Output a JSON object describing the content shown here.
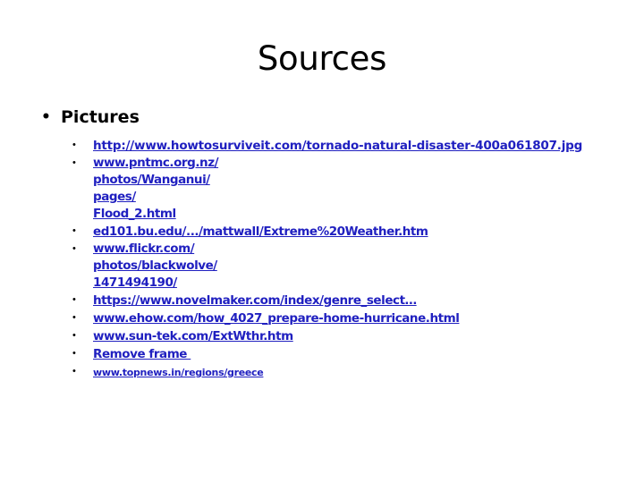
{
  "slide": {
    "title": "Sources",
    "background_color": "#FFFFFF",
    "title_color": "#000000",
    "link_color": "#2020C0",
    "bullet_glyph": "•"
  },
  "section": {
    "heading": "Pictures"
  },
  "links": [
    {
      "id": "link-howtosurviveit",
      "style": "strong",
      "lines": [
        "http://www.howtosurviveit.com/tornado-natural-disaster-400a061807.jpg"
      ]
    },
    {
      "id": "link-pntmc",
      "style": "normal",
      "lines": [
        "www.pntmc.org.nz/",
        "photos/Wanganui/",
        "pages/",
        "Flood_2.html"
      ]
    },
    {
      "id": "link-ed101-bu-edu",
      "style": "normal",
      "lines": [
        "ed101.bu.edu/.../mattwall/Extreme%20Weather.htm"
      ]
    },
    {
      "id": "link-flickr",
      "style": "normal",
      "lines": [
        "www.flickr.com/",
        "photos/blackwolve/",
        "1471494190/"
      ]
    },
    {
      "id": "link-novelmaker",
      "style": "normal",
      "lines": [
        "https://www.novelmaker.com/index/genre_select…"
      ]
    },
    {
      "id": "link-ehow",
      "style": "normal",
      "lines": [
        "www.ehow.com/how_4027_prepare-home-hurricane.html"
      ]
    },
    {
      "id": "link-sun-tek",
      "style": "normal",
      "lines": [
        "www.sun-tek.com/ExtWthr.htm"
      ]
    },
    {
      "id": "link-remove-frame",
      "style": "normal",
      "lines": [
        "Remove frame "
      ]
    },
    {
      "id": "link-topnews",
      "style": "small",
      "lines": [
        "www.topnews.in/regions/greece"
      ]
    }
  ]
}
